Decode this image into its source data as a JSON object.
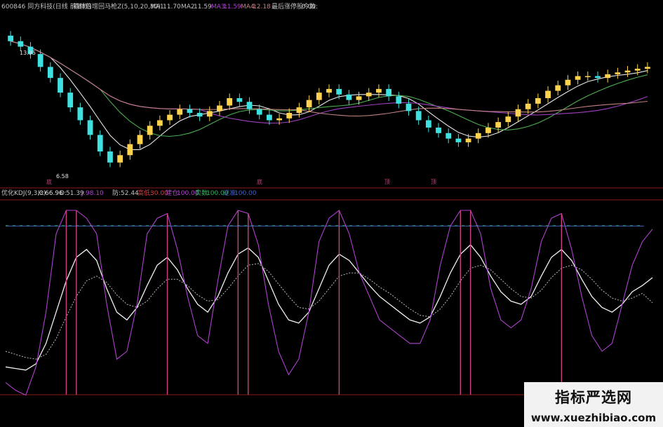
{
  "header": {
    "stock": "600846 同方科技(日线 前复权)",
    "indicator": "箱体倍增回马枪Z(5,10,20,30)",
    "ma1_label": "MA1:",
    "ma1": "11.70",
    "ma2_label": "MA2:",
    "ma2": "11.59",
    "ma3_label": "MA3:",
    "ma3": "11.59",
    "ma4_label": "MA4:",
    "ma4": "12.18",
    "extra_label": "最后涨停股今数:",
    "extra": "0.00"
  },
  "price_labels": {
    "high": "13.95",
    "low": "6.58"
  },
  "sub_header": {
    "name": "优化KDJ(9,3,3)",
    "k_label": "K:",
    "k": "66.96",
    "d_label": "D:",
    "d": "51.39",
    "j_label": "J:",
    "j": "98.10",
    "m1_label": "防:",
    "m1": "52.44",
    "m2_label": "高低:",
    "m2": "30.00",
    "m3_label": "建仓:",
    "m3": "100.00",
    "m4_label": "卖数:",
    "m4": "100.00",
    "m5_label": "逆准:",
    "m5": "100.00"
  },
  "marker_labels": [
    "底",
    "底",
    "顶",
    "顶"
  ],
  "watermark": {
    "title": "指标严选网",
    "url": "www.xuezhibiao.com"
  },
  "colors": {
    "bg": "#000000",
    "up": "#ffd34d",
    "down": "#3fe0e0",
    "grid_red": "#8b1a1a",
    "ma_white": "#e8e8e8",
    "ma_green": "#4caf50",
    "ma_purple": "#a040c0",
    "ma_pink": "#c08080",
    "k_line": "#f0f0f0",
    "d_line": "#bbbbbb",
    "j_line": "#b040d0",
    "box_blue": "#4060c0",
    "box_green": "#30b060",
    "spike": "#d04080"
  },
  "chart_data": [
    {
      "type": "candlestick",
      "title": "600846 同方科技(日线 前复权)",
      "ylim": [
        6.0,
        15.0
      ],
      "close": [
        13.6,
        13.3,
        12.9,
        12.2,
        11.6,
        10.8,
        10.0,
        9.3,
        8.5,
        7.6,
        7.0,
        7.4,
        8.0,
        8.5,
        9.0,
        9.3,
        9.6,
        9.9,
        9.7,
        9.5,
        9.8,
        10.1,
        10.5,
        10.3,
        9.9,
        9.6,
        9.3,
        9.4,
        9.7,
        10.0,
        10.4,
        10.8,
        11.0,
        10.7,
        10.4,
        10.6,
        10.8,
        11.0,
        10.6,
        10.2,
        9.8,
        9.3,
        8.9,
        8.6,
        8.3,
        8.1,
        8.3,
        8.6,
        8.9,
        9.2,
        9.5,
        9.9,
        10.2,
        10.5,
        10.9,
        11.2,
        11.5,
        11.7,
        11.7,
        11.6,
        11.8,
        11.9,
        12.0,
        12.1,
        12.2
      ],
      "annotations": [
        "13.95 high",
        "6.58 low"
      ]
    },
    {
      "type": "line",
      "title": "优化KDJ(9,3,3)",
      "ylim": [
        -10,
        110
      ],
      "series": [
        {
          "name": "K",
          "values": [
            10,
            9,
            8,
            12,
            25,
            45,
            65,
            80,
            85,
            78,
            60,
            45,
            40,
            48,
            62,
            75,
            80,
            72,
            60,
            50,
            45,
            55,
            70,
            82,
            86,
            80,
            65,
            50,
            40,
            38,
            45,
            60,
            75,
            82,
            78,
            70,
            62,
            55,
            50,
            45,
            40,
            38,
            42,
            55,
            70,
            82,
            88,
            80,
            68,
            58,
            52,
            50,
            55,
            68,
            80,
            85,
            78,
            66,
            55,
            48,
            45,
            50,
            58,
            62,
            67
          ]
        },
        {
          "name": "D",
          "values": [
            20,
            18,
            16,
            15,
            18,
            28,
            42,
            55,
            65,
            68,
            64,
            56,
            50,
            48,
            52,
            60,
            66,
            66,
            62,
            56,
            52,
            53,
            60,
            68,
            75,
            76,
            71,
            63,
            55,
            48,
            47,
            52,
            60,
            68,
            70,
            70,
            66,
            61,
            57,
            52,
            47,
            43,
            42,
            47,
            55,
            65,
            73,
            75,
            72,
            66,
            60,
            55,
            54,
            59,
            67,
            73,
            75,
            72,
            66,
            59,
            54,
            52,
            54,
            57,
            51
          ]
        },
        {
          "name": "J",
          "values": [
            0,
            -5,
            -8,
            10,
            45,
            95,
            110,
            110,
            105,
            95,
            50,
            15,
            20,
            50,
            95,
            105,
            108,
            85,
            55,
            30,
            25,
            65,
            100,
            110,
            108,
            88,
            50,
            20,
            5,
            15,
            45,
            90,
            105,
            110,
            95,
            70,
            55,
            40,
            35,
            30,
            25,
            25,
            40,
            75,
            100,
            110,
            110,
            95,
            60,
            40,
            35,
            40,
            60,
            90,
            105,
            108,
            85,
            55,
            30,
            20,
            25,
            50,
            75,
            90,
            98
          ]
        }
      ]
    }
  ]
}
